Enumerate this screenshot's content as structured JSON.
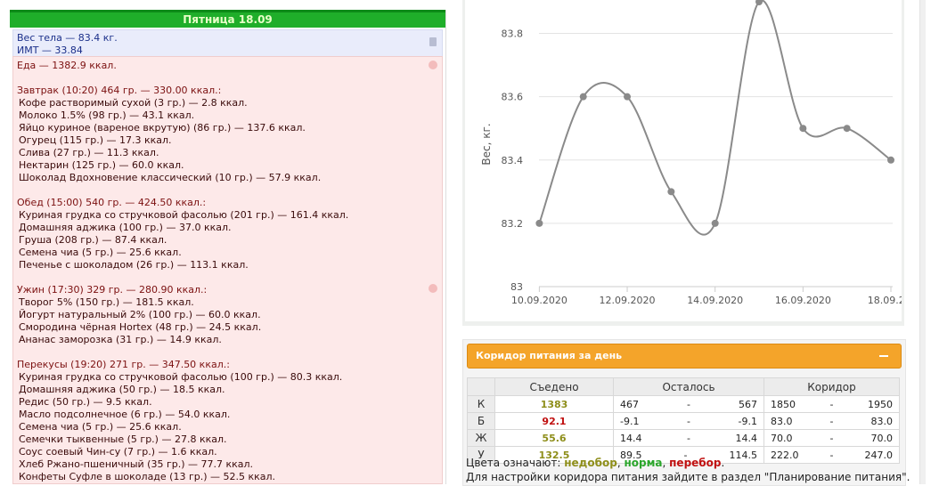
{
  "day": {
    "title": "Пятница 18.09"
  },
  "weight": {
    "line1": "Вес тела — 83.4 кг.",
    "line2": "ИМТ — 33.84"
  },
  "food": {
    "total": "Еда — 1382.9 ккал.",
    "meals": [
      {
        "title": "Завтрак (10:20) 464 гр. — 330.00 ккал.:",
        "items": [
          "Кофе растворимый сухой (3 гр.) — 2.8 ккал.",
          "Молоко 1.5% (98 гр.) — 43.1 ккал.",
          "Яйцо куриное (вареное вкрутую) (86 гр.) — 137.6 ккал.",
          "Огурец (115 гр.) — 17.3 ккал.",
          "Слива (27 гр.) — 11.3 ккал.",
          "Нектарин (125 гр.) — 60.0 ккал.",
          "Шоколад Вдохновение классический (10 гр.) — 57.9 ккал."
        ]
      },
      {
        "title": "Обед (15:00) 540 гр. — 424.50 ккал.:",
        "items": [
          "Куриная грудка со стручковой фасолью (201 гр.) — 161.4 ккал.",
          "Домашняя аджика (100 гр.) — 37.0 ккал.",
          "Груша (208 гр.) — 87.4 ккал.",
          "Семена чиа (5 гр.) — 25.6 ккал.",
          "Печенье с шоколадом (26 гр.) — 113.1 ккал."
        ]
      },
      {
        "title": "Ужин (17:30) 329 гр. — 280.90 ккал.:",
        "items": [
          "Творог 5% (150 гр.) — 181.5 ккал.",
          "Йогурт натуральный 2% (100 гр.) — 60.0 ккал.",
          "Смородина чёрная Hortex (48 гр.) — 24.5 ккал.",
          "Ананас заморозка (31 гр.) — 14.9 ккал."
        ]
      },
      {
        "title": "Перекусы (19:20) 271 гр. — 347.50 ккал.:",
        "items": [
          "Куриная грудка со стручковой фасолью (100 гр.) — 80.3 ккал.",
          "Домашняя аджика (50 гр.) — 18.5 ккал.",
          "Редис (50 гр.) — 9.5 ккал.",
          "Масло подсолнечное (6 гр.) — 54.0 ккал.",
          "Семена чиа (5 гр.) — 25.6 ккал.",
          "Семечки тыквенные (5 гр.) — 27.8 ккал.",
          "Соус соевый Чин-су (7 гр.) — 1.6 ккал.",
          "Хлеб Ржано-пшеничный (35 гр.) — 77.7 ккал.",
          "Конфеты Суфле в шоколаде (13 гр.) — 52.5 ккал."
        ]
      }
    ]
  },
  "chart_data": {
    "type": "line",
    "ylabel": "Вес, кг.",
    "xlabel": "",
    "title": "",
    "ylim": [
      83.0,
      83.9
    ],
    "yticks": [
      "83",
      "83.2",
      "83.4",
      "83.6",
      "83.8"
    ],
    "xticks": [
      "10.09.2020",
      "12.09.2020",
      "14.09.2020",
      "16.09.2020",
      "18.09.2..."
    ],
    "x": [
      "10.09.2020",
      "11.09.2020",
      "12.09.2020",
      "13.09.2020",
      "14.09.2020",
      "15.09.2020",
      "16.09.2020",
      "17.09.2020",
      "18.09.2020"
    ],
    "values": [
      83.2,
      83.6,
      83.6,
      83.3,
      83.2,
      83.9,
      83.5,
      83.5,
      83.4
    ],
    "series_color": "#8a8a8a",
    "grid": true
  },
  "corridor": {
    "title": "Коридор питания за день",
    "headers": {
      "eaten": "Съедено",
      "left": "Осталось",
      "corridor": "Коридор"
    },
    "rows": [
      {
        "label": "К",
        "eaten": "1383",
        "status": "under",
        "left_min": "467",
        "left_max": "567",
        "cor_min": "1850",
        "cor_max": "1950"
      },
      {
        "label": "Б",
        "eaten": "92.1",
        "status": "over",
        "left_min": "-9.1",
        "left_max": "-9.1",
        "cor_min": "83.0",
        "cor_max": "83.0"
      },
      {
        "label": "Ж",
        "eaten": "55.6",
        "status": "under",
        "left_min": "14.4",
        "left_max": "14.4",
        "cor_min": "70.0",
        "cor_max": "70.0"
      },
      {
        "label": "У",
        "eaten": "132.5",
        "status": "under",
        "left_min": "89.5",
        "left_max": "114.5",
        "cor_min": "222.0",
        "cor_max": "247.0"
      }
    ],
    "dash": "-",
    "legend": {
      "prefix": "Цвета означают: ",
      "under": "недобор",
      "sep1": ", ",
      "norm": "норма",
      "sep2": ", ",
      "over": "перебор",
      "suffix": "."
    },
    "note": "Для настройки коридора питания зайдите в раздел \"Планирование питания\"."
  },
  "colors": {
    "header_green": "#1fae2a",
    "under": "#8e8e1a",
    "norm": "#2aa52a",
    "over": "#c01010",
    "accent": "#f4a42a"
  }
}
